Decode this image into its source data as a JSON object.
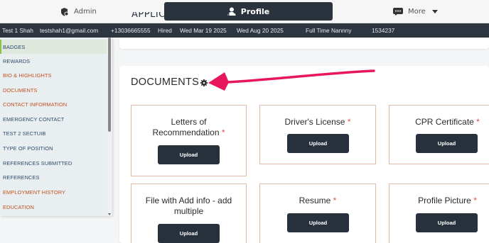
{
  "tabs": {
    "admin": "Admin",
    "profile": "Profile",
    "more": "More"
  },
  "infobar": {
    "name": "Test 1 Shah",
    "email": "testshah1@gmail.com",
    "phone": "+13036665555",
    "status": "Hired",
    "date1": "Wed Mar 19 2025",
    "date2": "Wed Aug 20 2025",
    "position": "Full Time Nannny",
    "id": "1534237"
  },
  "section_above": "APPLICATION DETAILS",
  "documents": {
    "title": "DOCUMENTS",
    "upload_label": "Upload",
    "items": [
      {
        "label": "Letters of Recommendation",
        "required": "*"
      },
      {
        "label": "Driver's License",
        "required": "*"
      },
      {
        "label": "CPR Certificate",
        "required": "*"
      },
      {
        "label": "File with Add info - add multiple",
        "required": ""
      },
      {
        "label": "Resume",
        "required": "*"
      },
      {
        "label": "Profile Picture",
        "required": "*"
      }
    ]
  },
  "sidebar": {
    "items": [
      {
        "label": "BADGES"
      },
      {
        "label": "REWARDS"
      },
      {
        "label": "BIO & HIGHLIGHTS"
      },
      {
        "label": "DOCUMENTS"
      },
      {
        "label": "CONTACT INFORMATION"
      },
      {
        "label": "EMERGENCY CONTACT"
      },
      {
        "label": "TEST 2 SECTUIB"
      },
      {
        "label": "TYPE OF POSITION"
      },
      {
        "label": "REFERENCES SUBMITTED"
      },
      {
        "label": "REFERENCES"
      },
      {
        "label": "EMPLOYMENT HISTORY"
      },
      {
        "label": "EDUCATION"
      }
    ]
  },
  "colors": {
    "dark": "#2a333d",
    "accent_required": "#d9534f",
    "annotation_arrow": "#e8175d",
    "sidebar_active": "#8bc34a"
  }
}
